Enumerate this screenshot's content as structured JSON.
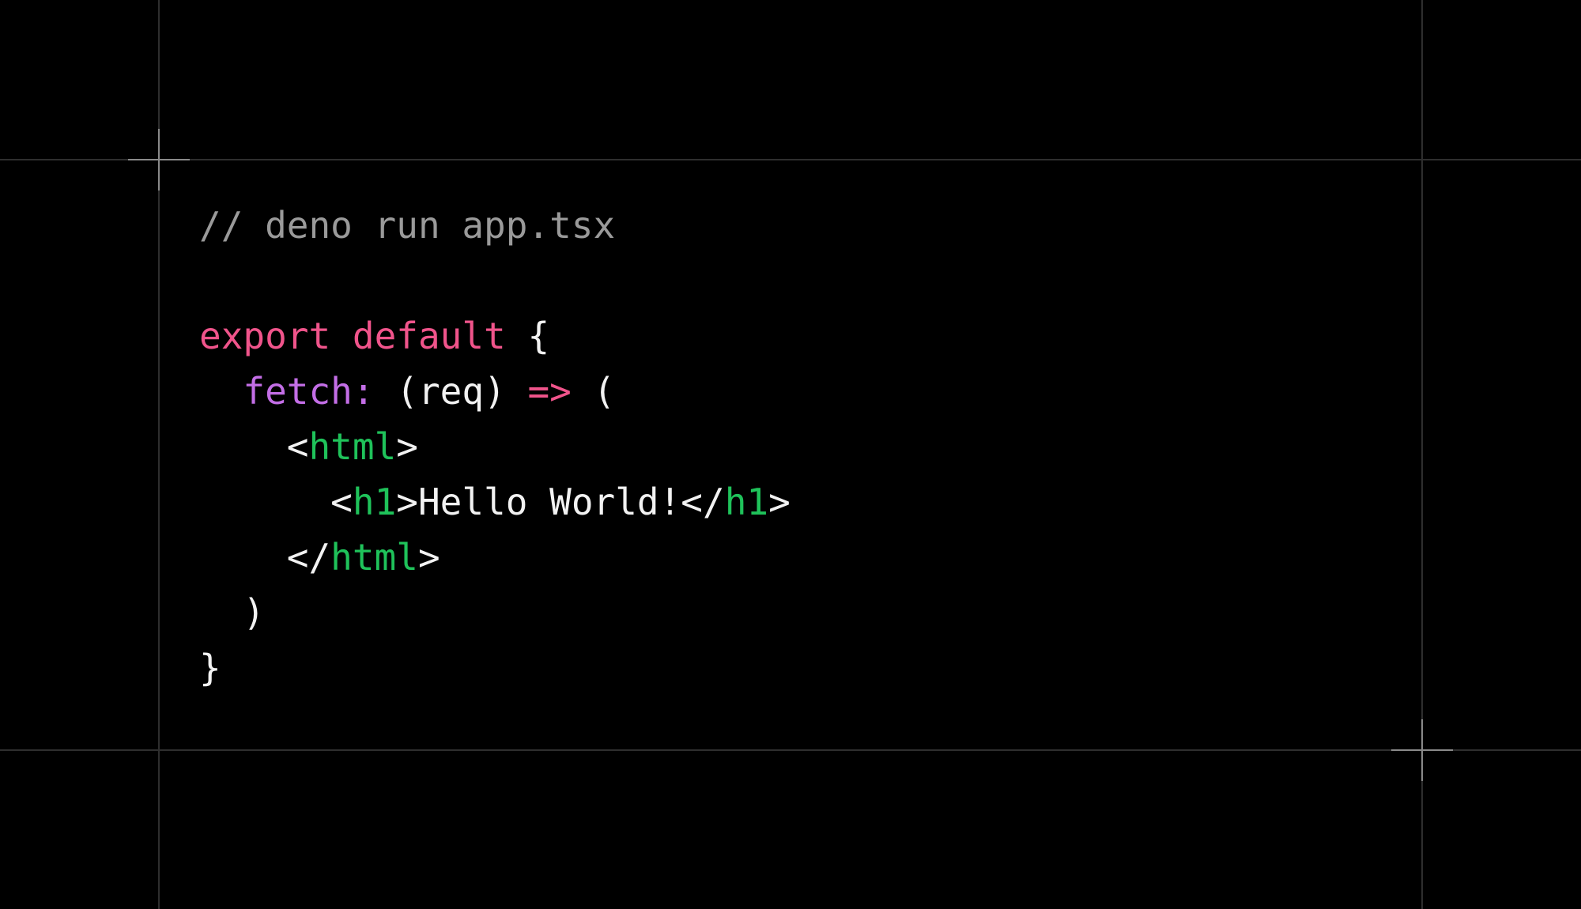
{
  "colors": {
    "background": "#000000",
    "grid_line": "#2e2e2e",
    "crosshair": "#8a8a8a",
    "comment": "#9a9a9a",
    "keyword": "#f0548b",
    "property": "#c36ee6",
    "tag": "#1fc25a",
    "default": "#f2f2f2"
  },
  "code": {
    "lines": [
      [
        {
          "text": "// deno run app.tsx",
          "kind": "comment"
        }
      ],
      [],
      [
        {
          "text": "export",
          "kind": "keyword"
        },
        {
          "text": " ",
          "kind": "default"
        },
        {
          "text": "default",
          "kind": "keyword"
        },
        {
          "text": " {",
          "kind": "default"
        }
      ],
      [
        {
          "text": "  ",
          "kind": "default"
        },
        {
          "text": "fetch:",
          "kind": "property"
        },
        {
          "text": " (req) ",
          "kind": "default"
        },
        {
          "text": "=>",
          "kind": "keyword"
        },
        {
          "text": " (",
          "kind": "default"
        }
      ],
      [
        {
          "text": "    <",
          "kind": "default"
        },
        {
          "text": "html",
          "kind": "tag"
        },
        {
          "text": ">",
          "kind": "default"
        }
      ],
      [
        {
          "text": "      <",
          "kind": "default"
        },
        {
          "text": "h1",
          "kind": "tag"
        },
        {
          "text": ">Hello World!</",
          "kind": "default"
        },
        {
          "text": "h1",
          "kind": "tag"
        },
        {
          "text": ">",
          "kind": "default"
        }
      ],
      [
        {
          "text": "    </",
          "kind": "default"
        },
        {
          "text": "html",
          "kind": "tag"
        },
        {
          "text": ">",
          "kind": "default"
        }
      ],
      [
        {
          "text": "  )",
          "kind": "default"
        }
      ],
      [
        {
          "text": "}",
          "kind": "default"
        }
      ]
    ]
  }
}
